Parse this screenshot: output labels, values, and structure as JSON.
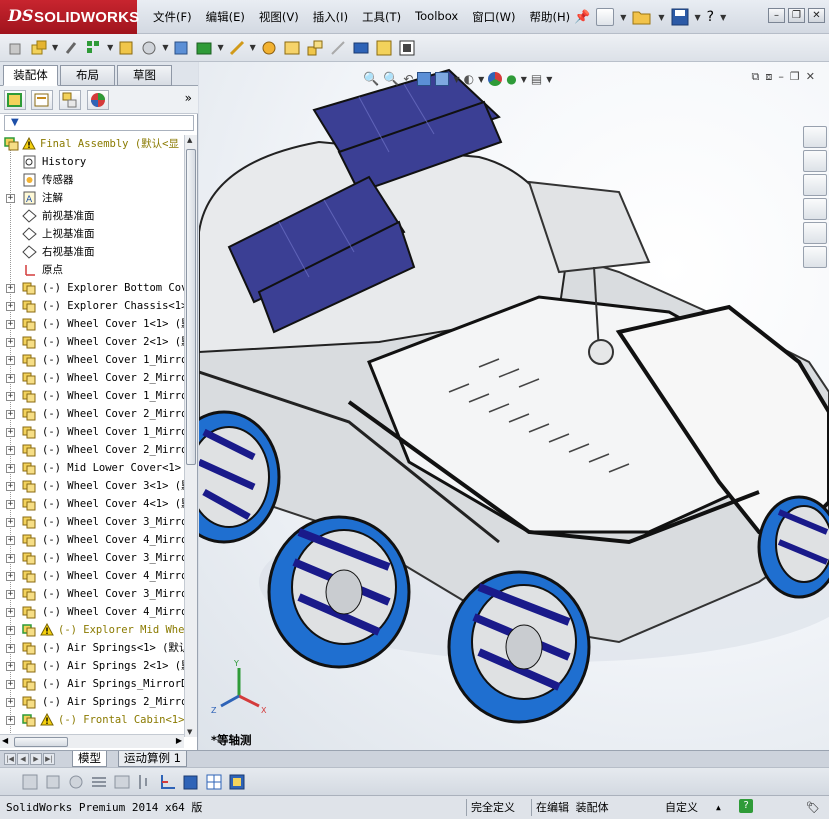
{
  "app": {
    "brand_ds": "DS",
    "brand_name": "SOLIDWORKS"
  },
  "menubar": {
    "items": [
      "文件(F)",
      "编辑(E)",
      "视图(V)",
      "插入(I)",
      "工具(T)",
      "Toolbox",
      "窗口(W)",
      "帮助(H)"
    ]
  },
  "featuremanager": {
    "tabs": [
      "装配体",
      "布局",
      "草图"
    ],
    "filter_placeholder": "",
    "tree": [
      {
        "label": "Final Assembly  (默认<显",
        "kind": "root",
        "warn": true
      },
      {
        "label": "History",
        "kind": "history"
      },
      {
        "label": "传感器",
        "kind": "sensor"
      },
      {
        "label": "注解",
        "kind": "annotation",
        "expandable": true
      },
      {
        "label": "前视基准面",
        "kind": "plane"
      },
      {
        "label": "上视基准面",
        "kind": "plane"
      },
      {
        "label": "右视基准面",
        "kind": "plane"
      },
      {
        "label": "原点",
        "kind": "origin"
      },
      {
        "label": "(-) Explorer Bottom Cov",
        "kind": "part",
        "expandable": true
      },
      {
        "label": "(-) Explorer Chassis<1>",
        "kind": "part",
        "expandable": true
      },
      {
        "label": "(-) Wheel Cover 1<1> (默",
        "kind": "part",
        "expandable": true
      },
      {
        "label": "(-) Wheel Cover 2<1> (默",
        "kind": "part",
        "expandable": true
      },
      {
        "label": "(-) Wheel Cover 1_Mirro",
        "kind": "part",
        "expandable": true
      },
      {
        "label": "(-) Wheel Cover 2_Mirro",
        "kind": "part",
        "expandable": true
      },
      {
        "label": "(-) Wheel Cover 1_Mirro",
        "kind": "part",
        "expandable": true
      },
      {
        "label": "(-) Wheel Cover 2_Mirro",
        "kind": "part",
        "expandable": true
      },
      {
        "label": "(-) Wheel Cover 1_Mirro",
        "kind": "part",
        "expandable": true
      },
      {
        "label": "(-) Wheel Cover 2_Mirro",
        "kind": "part",
        "expandable": true
      },
      {
        "label": "(-) Mid Lower Cover<1>",
        "kind": "part",
        "expandable": true
      },
      {
        "label": "(-) Wheel Cover 3<1> (默",
        "kind": "part",
        "expandable": true
      },
      {
        "label": "(-) Wheel Cover 4<1> (默",
        "kind": "part",
        "expandable": true
      },
      {
        "label": "(-) Wheel Cover 3_Mirro",
        "kind": "part",
        "expandable": true
      },
      {
        "label": "(-) Wheel Cover 4_Mirro",
        "kind": "part",
        "expandable": true
      },
      {
        "label": "(-) Wheel Cover 3_Mirro",
        "kind": "part",
        "expandable": true
      },
      {
        "label": "(-) Wheel Cover 4_Mirro",
        "kind": "part",
        "expandable": true
      },
      {
        "label": "(-) Wheel Cover 3_Mirro",
        "kind": "part",
        "expandable": true
      },
      {
        "label": "(-) Wheel Cover 4_Mirro",
        "kind": "part",
        "expandable": true
      },
      {
        "label": "(-) Explorer Mid Whe",
        "kind": "subasm",
        "expandable": true,
        "warn": true
      },
      {
        "label": "(-) Air Springs<1> (默认",
        "kind": "part",
        "expandable": true
      },
      {
        "label": "(-) Air Springs 2<1> (默",
        "kind": "part",
        "expandable": true
      },
      {
        "label": "(-) Air Springs_MirrorD",
        "kind": "part",
        "expandable": true
      },
      {
        "label": "(-) Air Springs 2_Mirro",
        "kind": "part",
        "expandable": true
      },
      {
        "label": "(-) Frontal Cabin<1>",
        "kind": "subasm",
        "expandable": true,
        "warn": true
      }
    ]
  },
  "viewport": {
    "view_label": "*等轴测",
    "triad": {
      "x": "X",
      "y": "Y",
      "z": "Z"
    }
  },
  "bottomtabs": [
    "模型",
    "运动算例 1"
  ],
  "statusbar": {
    "product": "SolidWorks Premium 2014 x64 版",
    "definition": "完全定义",
    "editing": "在编辑 装配体",
    "units": "自定义",
    "help": "?"
  },
  "colors": {
    "brand_red": "#b51c25",
    "solar_blue": "#3b3f94",
    "wheel_blue": "#1f6fd0",
    "tree_warn_text": "#8a7a00"
  }
}
